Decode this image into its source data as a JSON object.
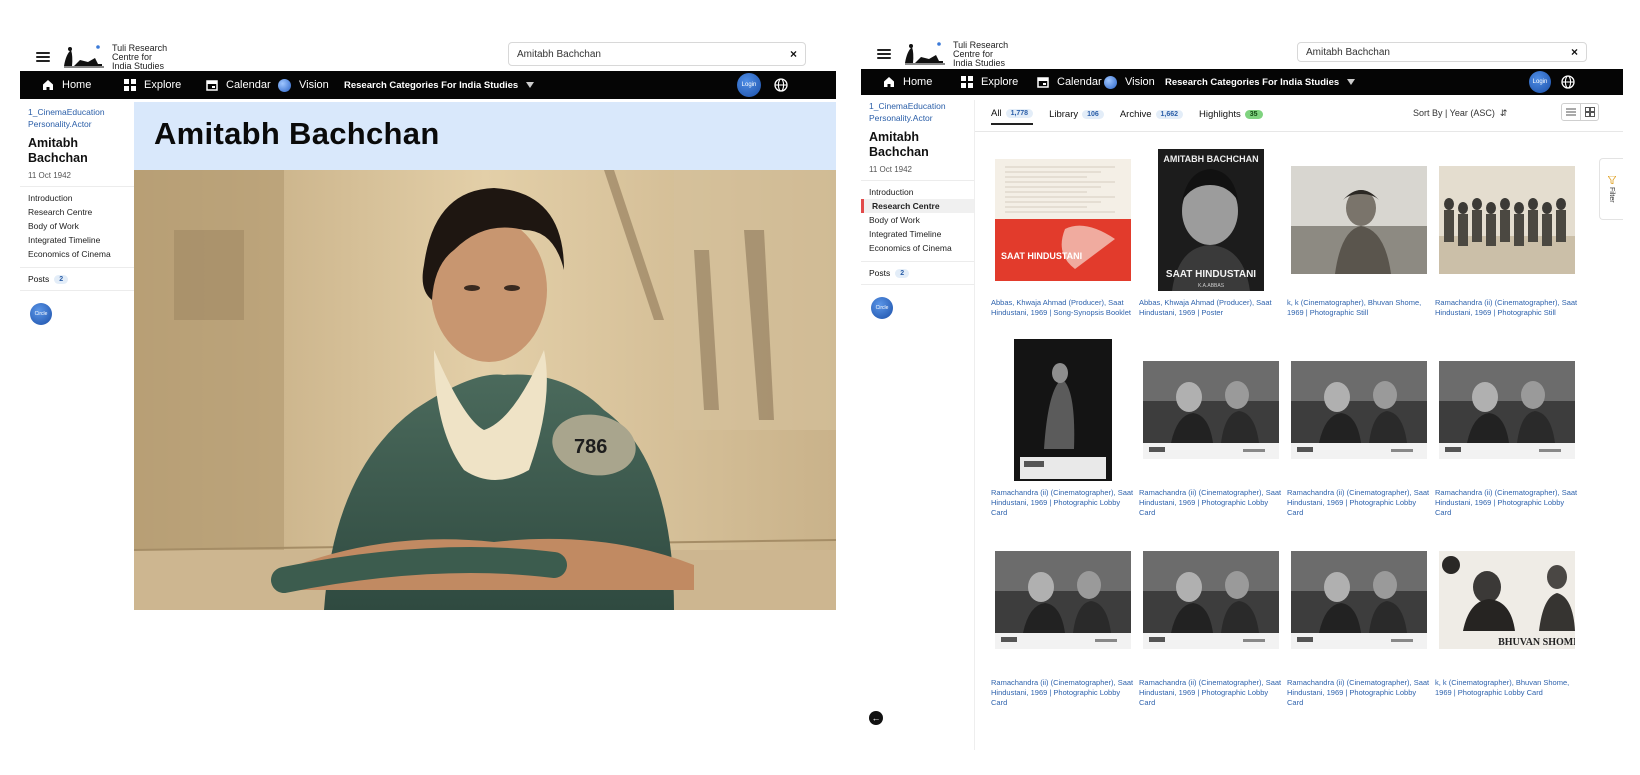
{
  "left": {
    "header": {
      "logo_lines": [
        "Tuli Research",
        "Centre for",
        "India Studies"
      ],
      "search_value": "Amitabh Bachchan",
      "clear_glyph": "×"
    },
    "nav": {
      "home": "Home",
      "explore": "Explore",
      "calendar": "Calendar",
      "vision": "Vision",
      "categories": "Research Categories For India Studies",
      "login": "Login"
    },
    "sidebar": {
      "crumbs": [
        "1_CinemaEducation",
        "Personality.Actor"
      ],
      "name_lines": [
        "Amitabh",
        "Bachchan"
      ],
      "date": "11 Oct 1942",
      "links": [
        "Introduction",
        "Research Centre",
        "Body of Work",
        "Integrated Timeline",
        "Economics of Cinema"
      ],
      "posts_label": "Posts",
      "posts_count": "2",
      "circle_label": "Circle"
    },
    "title": "Amitabh Bachchan"
  },
  "right": {
    "header": {
      "logo_lines": [
        "Tuli Research",
        "Centre for",
        "India Studies"
      ],
      "search_value": "Amitabh Bachchan",
      "clear_glyph": "×"
    },
    "nav": {
      "home": "Home",
      "explore": "Explore",
      "calendar": "Calendar",
      "vision": "Vision",
      "categories": "Research Categories For India Studies",
      "login": "Login"
    },
    "sidebar": {
      "crumbs": [
        "1_CinemaEducation",
        "Personality.Actor"
      ],
      "name_lines": [
        "Amitabh",
        "Bachchan"
      ],
      "date": "11 Oct 1942",
      "links": [
        "Introduction",
        "Research Centre",
        "Body of Work",
        "Integrated Timeline",
        "Economics of Cinema"
      ],
      "active_link": "Research Centre",
      "posts_label": "Posts",
      "posts_count": "2",
      "circle_label": "Circle"
    },
    "tabs": [
      {
        "label": "All",
        "count": "1,778",
        "active": true
      },
      {
        "label": "Library",
        "count": "106"
      },
      {
        "label": "Archive",
        "count": "1,662"
      },
      {
        "label": "Highlights",
        "count": "35"
      }
    ],
    "sort_label": "Sort By | Year (ASC)",
    "filter_label": "Filter",
    "items": [
      {
        "caption": "Abbas, Khwaja Ahmad (Producer), Saat Hindustani, 1969 | Song-Synopsis Booklet",
        "thumb": "booklet"
      },
      {
        "caption": "Abbas, Khwaja Ahmad (Producer), Saat Hindustani, 1969 | Poster",
        "thumb": "poster"
      },
      {
        "caption": "k, k (Cinematographer), Bhuvan Shome, 1969 | Photographic Still",
        "thumb": "still-a"
      },
      {
        "caption": "Ramachandra (ii) (Cinematographer), Saat Hindustani, 1969 | Photographic Still",
        "thumb": "still-b"
      },
      {
        "caption": "Ramachandra (ii) (Cinematographer), Saat Hindustani, 1969 | Photographic Lobby Card",
        "thumb": "portrait"
      },
      {
        "caption": "Ramachandra (ii) (Cinematographer), Saat Hindustani, 1969 | Photographic Lobby Card",
        "thumb": "lobby"
      },
      {
        "caption": "Ramachandra (ii) (Cinematographer), Saat Hindustani, 1969 | Photographic Lobby Card",
        "thumb": "lobby"
      },
      {
        "caption": "Ramachandra (ii) (Cinematographer), Saat Hindustani, 1969 | Photographic Lobby Card",
        "thumb": "lobby"
      },
      {
        "caption": "Ramachandra (ii) (Cinematographer), Saat Hindustani, 1969 | Photographic Lobby Card",
        "thumb": "lobby"
      },
      {
        "caption": "Ramachandra (ii) (Cinematographer), Saat Hindustani, 1969 | Photographic Lobby Card",
        "thumb": "lobby"
      },
      {
        "caption": "Ramachandra (ii) (Cinematographer), Saat Hindustani, 1969 | Photographic Lobby Card",
        "thumb": "lobby"
      },
      {
        "caption": "k, k (Cinematographer), Bhuvan Shome, 1969 | Photographic Lobby Card",
        "thumb": "bhuvan"
      }
    ],
    "poster_text": {
      "top": "AMITABH BACHCHAN",
      "bottom": "SAAT HINDUSTANI",
      "credit": "K.A.ABBAS"
    },
    "booklet_text": "SAAT HINDUSTANI",
    "bhuvan_text": "BHUVAN SHOME",
    "back_glyph": "←"
  },
  "colors": {
    "accent_blue": "#2f63ad",
    "navbar": "#050505",
    "title_band": "#d9e8fb",
    "active_marker": "#e24b4b",
    "highlight_pill": "#7fd37f"
  }
}
